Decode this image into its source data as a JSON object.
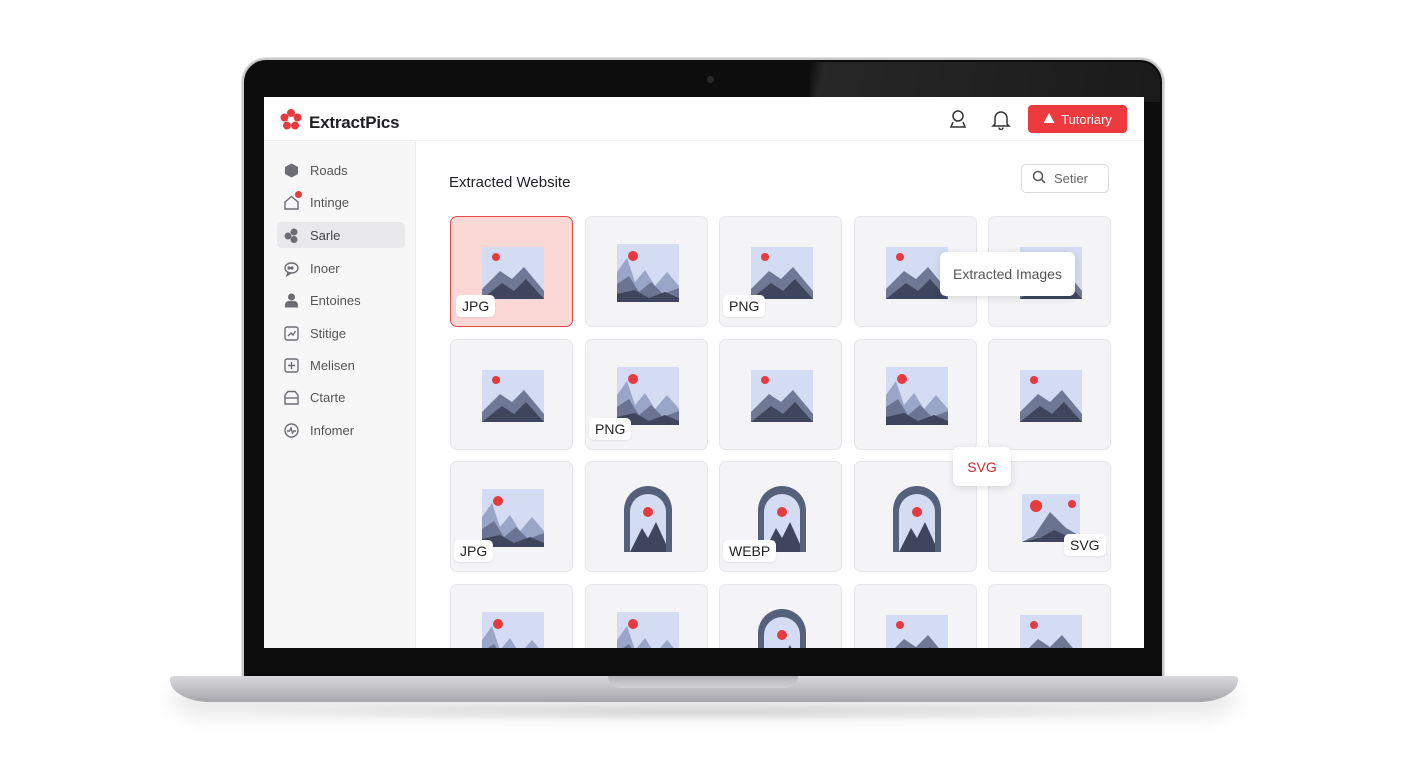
{
  "app": {
    "name": "ExtractPics",
    "tutorial_label": "Tutoriary"
  },
  "sidebar": {
    "items": [
      {
        "label": "Roads",
        "icon": "cube-icon"
      },
      {
        "label": "Intinge",
        "icon": "home-icon",
        "badge": true
      },
      {
        "label": "Sarle",
        "icon": "shapes-icon",
        "active": true
      },
      {
        "label": "Inoer",
        "icon": "chat-icon"
      },
      {
        "label": "Entoines",
        "icon": "user-icon"
      },
      {
        "label": "Stitige",
        "icon": "chart-icon"
      },
      {
        "label": "Melisen",
        "icon": "plus-box-icon"
      },
      {
        "label": "Ctarte",
        "icon": "folder-icon"
      },
      {
        "label": "Infomer",
        "icon": "pulse-icon"
      }
    ]
  },
  "main": {
    "title": "Extracted Website",
    "search_placeholder": "Setier",
    "floating_label": "Extracted Images",
    "floating_svg_label": "SVG"
  },
  "badges": {
    "r0c0": "JPG",
    "r0c2": "PNG",
    "r1c1": "PNG",
    "r2c0": "JPG",
    "r2c2": "WEBP",
    "r2c4": "SVG"
  },
  "colors": {
    "accent": "#ec3a3f",
    "selected_tile": "#fbd7d6",
    "image_sky": "#d3dcf2",
    "image_mountain": "#3e455c",
    "image_sun": "#e53b3f"
  }
}
